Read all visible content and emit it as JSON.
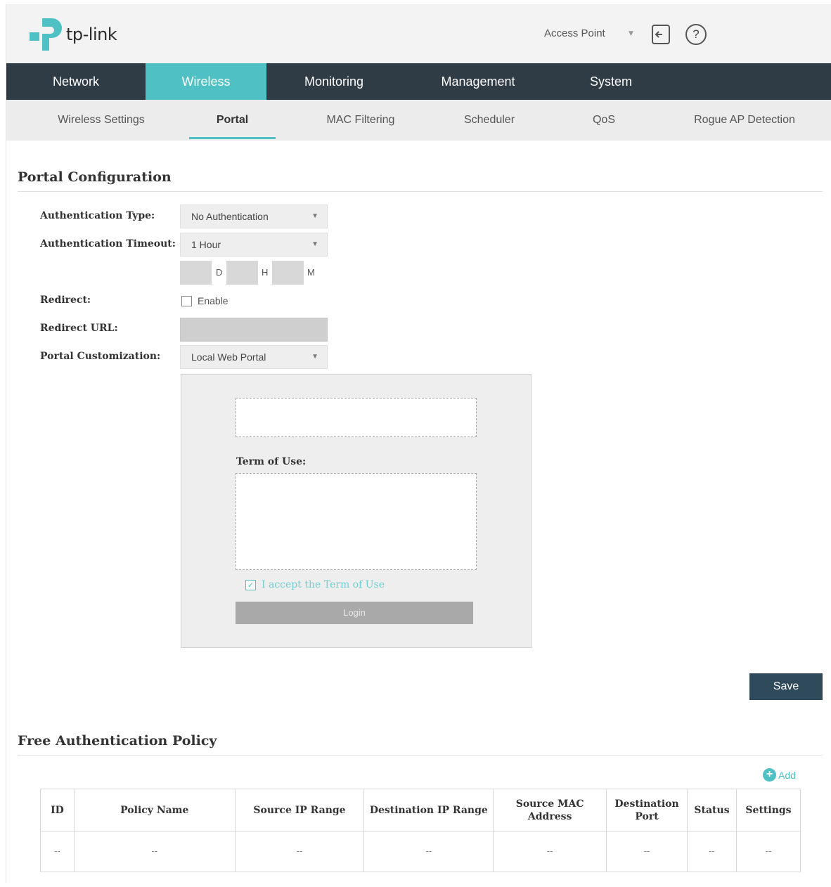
{
  "header": {
    "brand": "tp-link",
    "mode": "Access Point"
  },
  "colors": {
    "accent": "#4fc1c4",
    "nav_bg": "#2f3b45",
    "save_bg": "#2f4a5a"
  },
  "main_nav": [
    {
      "label": "Network",
      "active": false
    },
    {
      "label": "Wireless",
      "active": true
    },
    {
      "label": "Monitoring",
      "active": false
    },
    {
      "label": "Management",
      "active": false
    },
    {
      "label": "System",
      "active": false
    }
  ],
  "sub_nav": [
    {
      "label": "Wireless Settings",
      "active": false
    },
    {
      "label": "Portal",
      "active": true
    },
    {
      "label": "MAC Filtering",
      "active": false
    },
    {
      "label": "Scheduler",
      "active": false
    },
    {
      "label": "QoS",
      "active": false
    },
    {
      "label": "Rogue AP Detection",
      "active": false
    }
  ],
  "portal": {
    "title": "Portal Configuration",
    "auth_type_label": "Authentication Type:",
    "auth_type_value": "No Authentication",
    "auth_timeout_label": "Authentication Timeout:",
    "auth_timeout_value": "1 Hour",
    "unit_d": "D",
    "unit_h": "H",
    "unit_m": "M",
    "redirect_label": "Redirect:",
    "redirect_enable": "Enable",
    "redirect_checked": false,
    "redirect_url_label": "Redirect URL:",
    "customization_label": "Portal Customization:",
    "customization_value": "Local Web Portal",
    "preview": {
      "term_label": "Term of Use:",
      "accept_label": "I accept the Term of Use",
      "accept_checked": true,
      "login_label": "Login"
    },
    "save_label": "Save"
  },
  "free_auth": {
    "title": "Free Authentication Policy",
    "add_label": "Add",
    "columns": [
      "ID",
      "Policy Name",
      "Source IP Range",
      "Destination IP Range",
      "Source MAC Address",
      "Destination Port",
      "Status",
      "Settings"
    ],
    "rows": [
      [
        "--",
        "--",
        "--",
        "--",
        "--",
        "--",
        "--",
        "--"
      ]
    ]
  }
}
